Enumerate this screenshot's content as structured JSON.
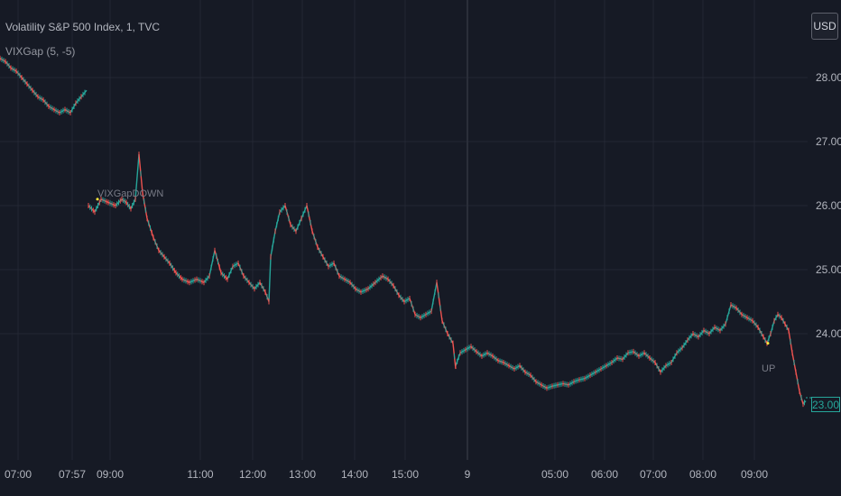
{
  "header": {
    "symbol_title": "Volatility S&P 500 Index, 1, TVC",
    "indicator_title": "VIXGap (5, -5)",
    "currency": "USD"
  },
  "colors": {
    "background": "#161a25",
    "grid": "#232733",
    "up": "#26a69a",
    "down": "#ef5350",
    "text": "#b2b5be"
  },
  "markers": {
    "down_label": "VIXGapDOWN",
    "up_label": "UP"
  },
  "last_price": "23.00",
  "chart_data": {
    "type": "line",
    "title": "Volatility S&P 500 Index, 1, TVC",
    "xlabel": "",
    "ylabel": "",
    "ylim": [
      22.6,
      28.7
    ],
    "y_ticks": [
      "28.00",
      "27.00",
      "26.00",
      "25.00",
      "24.00"
    ],
    "x_ticks": [
      "07:00",
      "07:57",
      "09:00",
      "11:00",
      "12:00",
      "13:00",
      "14:00",
      "15:00",
      "9",
      "05:00",
      "06:00",
      "07:00",
      "08:00",
      "09:00"
    ],
    "grid": true,
    "series": [
      {
        "name": "",
        "segments": [
          {
            "x": [
              0,
              6,
              12,
              18,
              24,
              30,
              36,
              42,
              48,
              54,
              60,
              66,
              72,
              78,
              84,
              90,
              96
            ],
            "y": [
              28.3,
              28.25,
              28.15,
              28.1,
              28.0,
              27.9,
              27.8,
              27.7,
              27.65,
              27.55,
              27.5,
              27.45,
              27.5,
              27.45,
              27.6,
              27.7,
              27.8
            ]
          },
          {
            "x": [
              98,
              105,
              112,
              120,
              128,
              135,
              140,
              145,
              150,
              154,
              158,
              163,
              170,
              176,
              182,
              188,
              195,
              202,
              210,
              218,
              226,
              232,
              238,
              245,
              252,
              258,
              264,
              270,
              276,
              282,
              288,
              294,
              298,
              300,
              305,
              310,
              316,
              322,
              328,
              334,
              340,
              346,
              352,
              358,
              364,
              370,
              376,
              382,
              388,
              394,
              400,
              408,
              416,
              424,
              430,
              436,
              442,
              448,
              454,
              460,
              466,
              472,
              478,
              484,
              490,
              496,
              502,
              505
            ],
            "y": [
              26.0,
              25.9,
              26.1,
              26.05,
              26.0,
              26.1,
              26.05,
              25.95,
              26.1,
              26.8,
              26.2,
              25.8,
              25.5,
              25.3,
              25.2,
              25.1,
              24.95,
              24.85,
              24.8,
              24.85,
              24.8,
              24.9,
              25.3,
              24.95,
              24.85,
              25.05,
              25.1,
              24.9,
              24.8,
              24.7,
              24.8,
              24.65,
              24.5,
              25.2,
              25.6,
              25.9,
              26.0,
              25.7,
              25.6,
              25.8,
              26.0,
              25.6,
              25.35,
              25.2,
              25.05,
              25.1,
              24.9,
              24.85,
              24.8,
              24.7,
              24.65,
              24.7,
              24.8,
              24.9,
              24.85,
              24.75,
              24.6,
              24.5,
              24.55,
              24.3,
              24.25,
              24.3,
              24.35,
              24.8,
              24.2,
              24.0,
              23.85,
              23.45
            ]
          },
          {
            "x": [
              505,
              510,
              516,
              522,
              528,
              534,
              540,
              546,
              552,
              558,
              564,
              570,
              576,
              582,
              588,
              594,
              600,
              606,
              612,
              618,
              624,
              630,
              636,
              642,
              648,
              654,
              660,
              666,
              672,
              678,
              684,
              690,
              696,
              702,
              708,
              714,
              720,
              726,
              732,
              738,
              744,
              750,
              756,
              762,
              768,
              774,
              780,
              786,
              792,
              798,
              804,
              810,
              816,
              822,
              828,
              834,
              840,
              846,
              850,
              854,
              858,
              862,
              866,
              870,
              874,
              878,
              882,
              886,
              890,
              893
            ],
            "y": [
              23.5,
              23.7,
              23.75,
              23.8,
              23.72,
              23.65,
              23.7,
              23.65,
              23.58,
              23.55,
              23.5,
              23.45,
              23.5,
              23.4,
              23.35,
              23.25,
              23.2,
              23.15,
              23.18,
              23.2,
              23.22,
              23.2,
              23.25,
              23.28,
              23.3,
              23.35,
              23.4,
              23.45,
              23.5,
              23.55,
              23.62,
              23.6,
              23.7,
              23.72,
              23.65,
              23.7,
              23.62,
              23.55,
              23.4,
              23.5,
              23.55,
              23.7,
              23.78,
              23.9,
              24.0,
              23.95,
              24.05,
              24.0,
              24.1,
              24.05,
              24.15,
              24.45,
              24.4,
              24.3,
              24.25,
              24.2,
              24.1,
              23.95,
              23.85,
              24.0,
              24.2,
              24.3,
              24.25,
              24.15,
              24.05,
              23.7,
              23.4,
              23.1,
              22.9,
              22.95
            ]
          }
        ]
      }
    ],
    "annotations": [
      {
        "label": "VIXGapDOWN",
        "x": 108,
        "y": 26.1
      },
      {
        "label": "UP",
        "x": 851,
        "y": 23.85
      }
    ]
  }
}
